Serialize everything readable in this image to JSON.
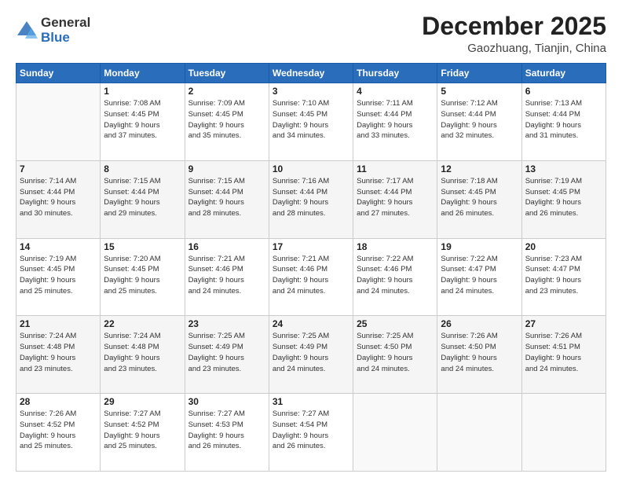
{
  "header": {
    "logo_general": "General",
    "logo_blue": "Blue",
    "month_title": "December 2025",
    "location": "Gaozhuang, Tianjin, China"
  },
  "days_of_week": [
    "Sunday",
    "Monday",
    "Tuesday",
    "Wednesday",
    "Thursday",
    "Friday",
    "Saturday"
  ],
  "weeks": [
    [
      {
        "num": "",
        "detail": ""
      },
      {
        "num": "1",
        "detail": "Sunrise: 7:08 AM\nSunset: 4:45 PM\nDaylight: 9 hours\nand 37 minutes."
      },
      {
        "num": "2",
        "detail": "Sunrise: 7:09 AM\nSunset: 4:45 PM\nDaylight: 9 hours\nand 35 minutes."
      },
      {
        "num": "3",
        "detail": "Sunrise: 7:10 AM\nSunset: 4:45 PM\nDaylight: 9 hours\nand 34 minutes."
      },
      {
        "num": "4",
        "detail": "Sunrise: 7:11 AM\nSunset: 4:44 PM\nDaylight: 9 hours\nand 33 minutes."
      },
      {
        "num": "5",
        "detail": "Sunrise: 7:12 AM\nSunset: 4:44 PM\nDaylight: 9 hours\nand 32 minutes."
      },
      {
        "num": "6",
        "detail": "Sunrise: 7:13 AM\nSunset: 4:44 PM\nDaylight: 9 hours\nand 31 minutes."
      }
    ],
    [
      {
        "num": "7",
        "detail": "Sunrise: 7:14 AM\nSunset: 4:44 PM\nDaylight: 9 hours\nand 30 minutes."
      },
      {
        "num": "8",
        "detail": "Sunrise: 7:15 AM\nSunset: 4:44 PM\nDaylight: 9 hours\nand 29 minutes."
      },
      {
        "num": "9",
        "detail": "Sunrise: 7:15 AM\nSunset: 4:44 PM\nDaylight: 9 hours\nand 28 minutes."
      },
      {
        "num": "10",
        "detail": "Sunrise: 7:16 AM\nSunset: 4:44 PM\nDaylight: 9 hours\nand 28 minutes."
      },
      {
        "num": "11",
        "detail": "Sunrise: 7:17 AM\nSunset: 4:44 PM\nDaylight: 9 hours\nand 27 minutes."
      },
      {
        "num": "12",
        "detail": "Sunrise: 7:18 AM\nSunset: 4:45 PM\nDaylight: 9 hours\nand 26 minutes."
      },
      {
        "num": "13",
        "detail": "Sunrise: 7:19 AM\nSunset: 4:45 PM\nDaylight: 9 hours\nand 26 minutes."
      }
    ],
    [
      {
        "num": "14",
        "detail": "Sunrise: 7:19 AM\nSunset: 4:45 PM\nDaylight: 9 hours\nand 25 minutes."
      },
      {
        "num": "15",
        "detail": "Sunrise: 7:20 AM\nSunset: 4:45 PM\nDaylight: 9 hours\nand 25 minutes."
      },
      {
        "num": "16",
        "detail": "Sunrise: 7:21 AM\nSunset: 4:46 PM\nDaylight: 9 hours\nand 24 minutes."
      },
      {
        "num": "17",
        "detail": "Sunrise: 7:21 AM\nSunset: 4:46 PM\nDaylight: 9 hours\nand 24 minutes."
      },
      {
        "num": "18",
        "detail": "Sunrise: 7:22 AM\nSunset: 4:46 PM\nDaylight: 9 hours\nand 24 minutes."
      },
      {
        "num": "19",
        "detail": "Sunrise: 7:22 AM\nSunset: 4:47 PM\nDaylight: 9 hours\nand 24 minutes."
      },
      {
        "num": "20",
        "detail": "Sunrise: 7:23 AM\nSunset: 4:47 PM\nDaylight: 9 hours\nand 23 minutes."
      }
    ],
    [
      {
        "num": "21",
        "detail": "Sunrise: 7:24 AM\nSunset: 4:48 PM\nDaylight: 9 hours\nand 23 minutes."
      },
      {
        "num": "22",
        "detail": "Sunrise: 7:24 AM\nSunset: 4:48 PM\nDaylight: 9 hours\nand 23 minutes."
      },
      {
        "num": "23",
        "detail": "Sunrise: 7:25 AM\nSunset: 4:49 PM\nDaylight: 9 hours\nand 23 minutes."
      },
      {
        "num": "24",
        "detail": "Sunrise: 7:25 AM\nSunset: 4:49 PM\nDaylight: 9 hours\nand 24 minutes."
      },
      {
        "num": "25",
        "detail": "Sunrise: 7:25 AM\nSunset: 4:50 PM\nDaylight: 9 hours\nand 24 minutes."
      },
      {
        "num": "26",
        "detail": "Sunrise: 7:26 AM\nSunset: 4:50 PM\nDaylight: 9 hours\nand 24 minutes."
      },
      {
        "num": "27",
        "detail": "Sunrise: 7:26 AM\nSunset: 4:51 PM\nDaylight: 9 hours\nand 24 minutes."
      }
    ],
    [
      {
        "num": "28",
        "detail": "Sunrise: 7:26 AM\nSunset: 4:52 PM\nDaylight: 9 hours\nand 25 minutes."
      },
      {
        "num": "29",
        "detail": "Sunrise: 7:27 AM\nSunset: 4:52 PM\nDaylight: 9 hours\nand 25 minutes."
      },
      {
        "num": "30",
        "detail": "Sunrise: 7:27 AM\nSunset: 4:53 PM\nDaylight: 9 hours\nand 26 minutes."
      },
      {
        "num": "31",
        "detail": "Sunrise: 7:27 AM\nSunset: 4:54 PM\nDaylight: 9 hours\nand 26 minutes."
      },
      {
        "num": "",
        "detail": ""
      },
      {
        "num": "",
        "detail": ""
      },
      {
        "num": "",
        "detail": ""
      }
    ]
  ]
}
